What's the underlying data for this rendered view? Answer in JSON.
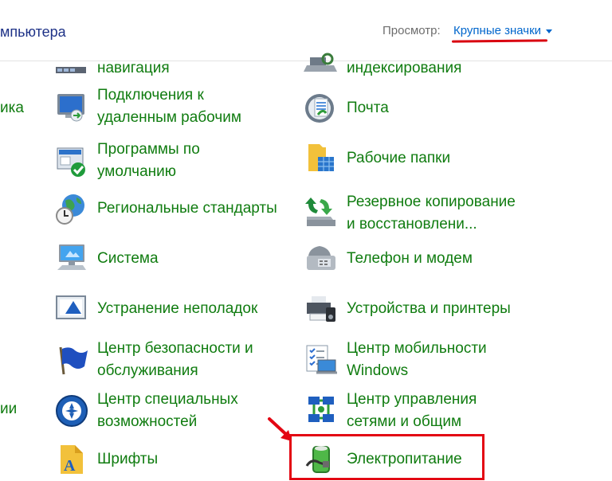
{
  "header": {
    "title": "мпьютера",
    "view_label": "Просмотр:",
    "view_value": "Крупные значки"
  },
  "left_fragments": [
    "ика",
    "ии"
  ],
  "left_column": [
    {
      "label": "навигация",
      "icon": "taskbar-navigation-icon"
    },
    {
      "label": "Подключения к\nудаленным рабочим",
      "icon": "remote-desktop-icon"
    },
    {
      "label": "Программы по\nумолчанию",
      "icon": "default-programs-icon"
    },
    {
      "label": "Региональные стандарты",
      "icon": "region-globe-icon"
    },
    {
      "label": "Система",
      "icon": "system-computer-icon"
    },
    {
      "label": "Устранение неполадок",
      "icon": "troubleshooting-icon"
    },
    {
      "label": "Центр безопасности и\nобслуживания",
      "icon": "security-flag-icon"
    },
    {
      "label": "Центр специальных\nвозможностей",
      "icon": "accessibility-icon"
    },
    {
      "label": "Шрифты",
      "icon": "fonts-folder-icon"
    }
  ],
  "right_column": [
    {
      "label": "индексирования",
      "icon": "indexing-options-icon"
    },
    {
      "label": "Почта",
      "icon": "mail-icon"
    },
    {
      "label": "Рабочие папки",
      "icon": "work-folders-icon"
    },
    {
      "label": "Резервное копирование\nи восстановлени...",
      "icon": "backup-restore-icon"
    },
    {
      "label": "Телефон и модем",
      "icon": "phone-modem-icon"
    },
    {
      "label": "Устройства и принтеры",
      "icon": "devices-printers-icon"
    },
    {
      "label": "Центр мобильности\nWindows",
      "icon": "mobility-center-icon"
    },
    {
      "label": "Центр управления\nсетями и общим",
      "icon": "network-center-icon"
    },
    {
      "label": "Электропитание",
      "icon": "power-options-icon"
    }
  ],
  "colors": {
    "link_green": "#107c10",
    "highlight_red": "#e30613",
    "select_blue": "#0066cc"
  }
}
